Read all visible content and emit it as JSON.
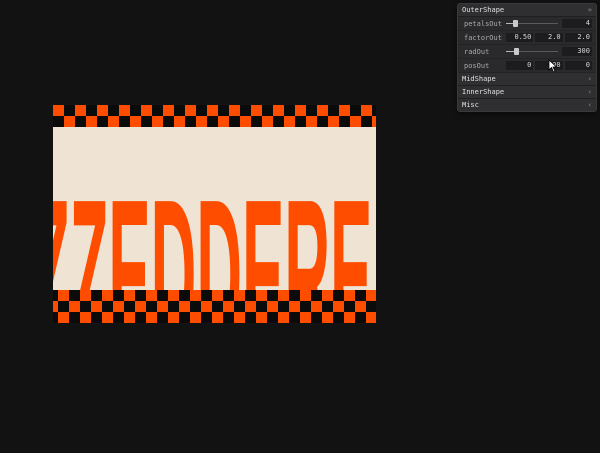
{
  "panel": {
    "outer": {
      "title": "OuterShape",
      "collapse_glyph": "»",
      "petals": {
        "label": "petalsOut",
        "value": "4",
        "level": 0.18
      },
      "factor": {
        "label": "factorOut",
        "values": [
          "0.50",
          "2.0",
          "2.0"
        ]
      },
      "rad": {
        "label": "radOut",
        "value": "300",
        "level": 0.2
      },
      "pos": {
        "label": "posOut",
        "values": [
          "0",
          "200",
          "0"
        ]
      }
    },
    "folders": [
      {
        "title": "MidShape",
        "chevron": "‹"
      },
      {
        "title": "InnerShape",
        "chevron": "‹"
      },
      {
        "title": "Misc",
        "chevron": "‹"
      }
    ]
  },
  "banner": {
    "text": "ZZEDDEREZ",
    "colors": {
      "accent": "#ff4d00",
      "cream": "#efe3d4",
      "dark": "#0b0b0b"
    }
  },
  "icons": [
    "chevron-icon",
    "cursor-icon"
  ]
}
